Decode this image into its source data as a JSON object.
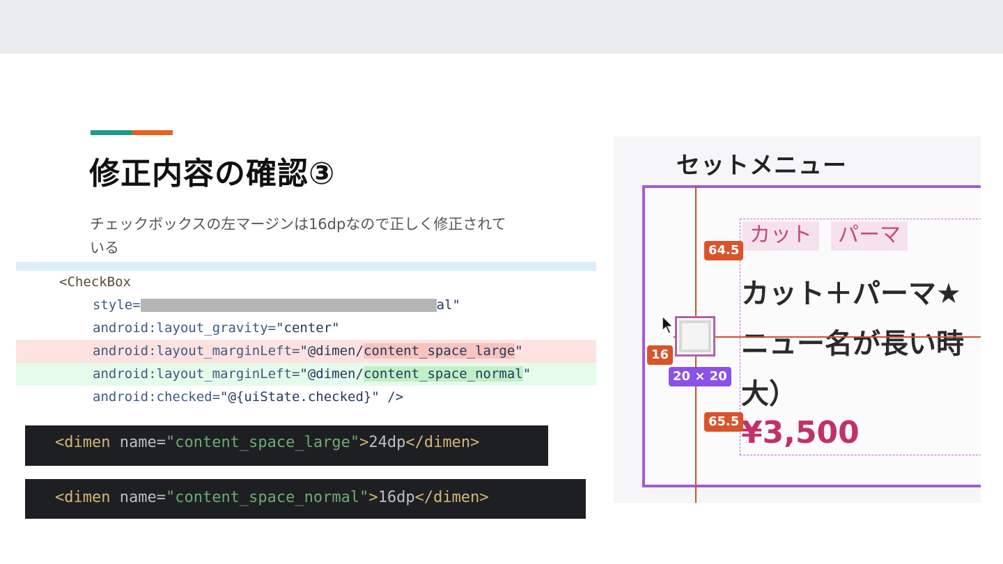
{
  "colors": {
    "teal": "#1e9a8c",
    "orange": "#e8601c",
    "purple": "#a55bd0"
  },
  "slide": {
    "title": "修正内容の確認③",
    "description": "チェックボックスの左マージンは16dpなので正しく修正されている"
  },
  "diff": {
    "line1": {
      "tag": "<CheckBox"
    },
    "line2": {
      "attr": "style=",
      "redacted": true,
      "tail": "al\""
    },
    "line3": {
      "attr": "android:layout_gravity=",
      "value": "\"center\""
    },
    "line4": {
      "attr": "android:layout_marginLeft=",
      "prefix": "\"@dimen/",
      "highlight": "content_space_large",
      "suffix": "\""
    },
    "line5": {
      "attr": "android:layout_marginLeft=",
      "prefix": "\"@dimen/",
      "highlight": "content_space_normal",
      "suffix": "\""
    },
    "line6": {
      "attr": "android:checked=",
      "value": "\"@{uiState.checked}\" />"
    }
  },
  "xml1": {
    "open": "<dimen",
    "attr": " name=",
    "value": "\"content_space_large\"",
    "close_start": ">",
    "text": "24dp",
    "close": "</dimen>"
  },
  "xml2": {
    "open": "<dimen",
    "attr": " name=",
    "value": "\"content_space_normal\"",
    "close_start": ">",
    "text": "16dp",
    "close": "</dimen>"
  },
  "preview": {
    "header": "セットメニュー",
    "tags": [
      "カット",
      "パーマ"
    ],
    "menu_name": "カット＋パーマ★\nニュー名が長い時\n大）",
    "price": "¥3,500",
    "measures": {
      "top": "64.5",
      "left": "16",
      "size": "20 × 20",
      "bottom": "65.5"
    }
  }
}
